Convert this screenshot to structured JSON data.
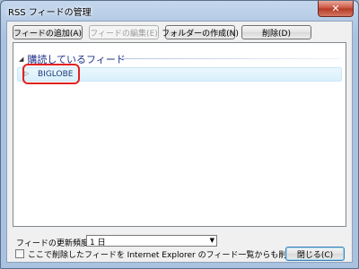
{
  "window": {
    "title": "RSS フィードの管理",
    "close_glyph": "✕"
  },
  "toolbar": {
    "add_feed": "フィードの追加(A)",
    "edit_feed": "フィードの編集(E)",
    "create_folder": "フォルダーの作成(N)",
    "delete": "削除(D)"
  },
  "feeds": {
    "group_label": "購読しているフィード",
    "items": [
      {
        "label": "BIGLOBE"
      }
    ]
  },
  "settings": {
    "frequency_label": "フィードの更新頻度(U):",
    "frequency_value": "1 日",
    "delete_checkbox_label": "ここで削除したフィードを Internet Explorer のフィード一覧からも削除する(F)",
    "delete_checkbox_checked": false
  },
  "footer": {
    "close_label": "閉じる(C)"
  },
  "colors": {
    "highlight": "#e22222",
    "selected_row": "#d9f0fc"
  }
}
